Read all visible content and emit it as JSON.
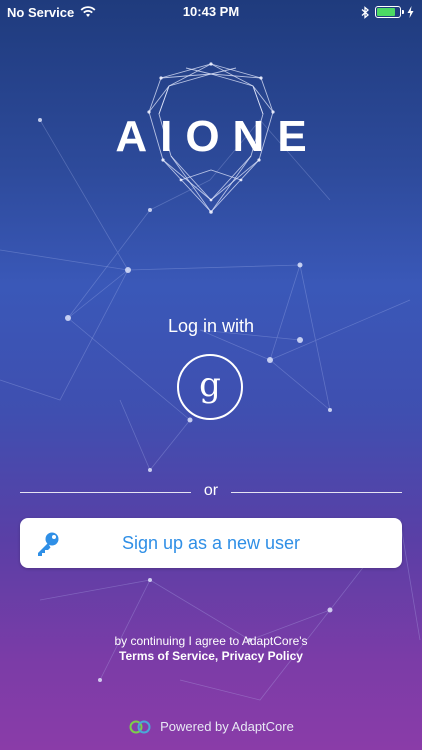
{
  "status_bar": {
    "carrier": "No Service",
    "time": "10:43 PM"
  },
  "logo": {
    "text": "AIONE"
  },
  "login": {
    "label": "Log in with",
    "google_glyph": "g"
  },
  "divider": {
    "text": "or"
  },
  "signup": {
    "label": "Sign up as a new user",
    "icon": "key-icon"
  },
  "terms": {
    "line1": "by continuing I agree to AdaptCore's",
    "terms_link": "Terms of Service,",
    "privacy_link": "Privacy Policy"
  },
  "footer": {
    "powered_by": "Powered by AdaptCore"
  },
  "colors": {
    "accent": "#2f8fe6",
    "battery": "#4cd964",
    "bg_top": "#1f3b7d",
    "bg_bottom": "#8a3ca8"
  }
}
